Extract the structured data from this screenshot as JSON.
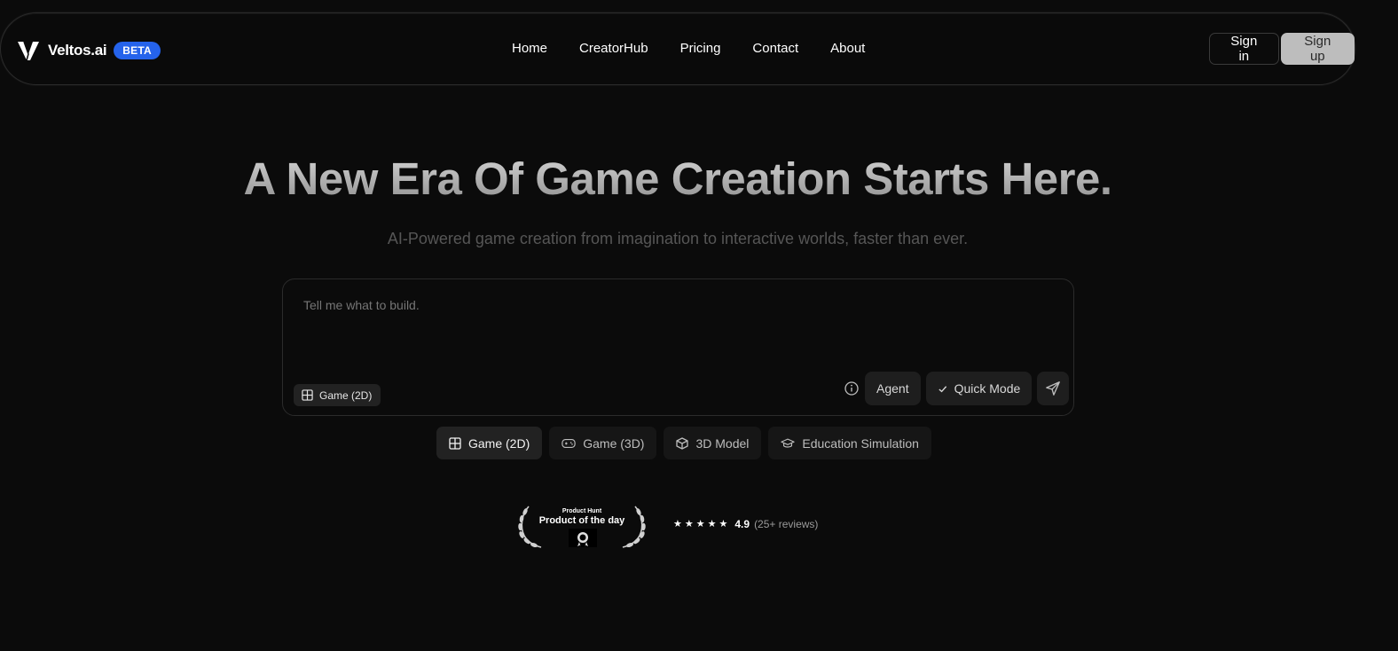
{
  "nav": {
    "brand_name": "Veltos.ai",
    "beta_label": "BETA",
    "links": [
      "Home",
      "CreatorHub",
      "Pricing",
      "Contact",
      "About"
    ],
    "signin_label": "Sign in",
    "signup_label": "Sign up"
  },
  "hero": {
    "title": "A New Era Of Game Creation Starts Here.",
    "subtitle": "AI-Powered game creation from imagination to interactive worlds, faster than ever."
  },
  "prompt": {
    "placeholder": "Tell me what to build.",
    "selected_mode": "Game (2D)",
    "agent_label": "Agent",
    "quick_mode_label": "Quick Mode"
  },
  "modes": [
    {
      "label": "Game (2D)",
      "icon": "grid-icon",
      "active": true
    },
    {
      "label": "Game (3D)",
      "icon": "gamepad-icon",
      "active": false
    },
    {
      "label": "3D Model",
      "icon": "cube-icon",
      "active": false
    },
    {
      "label": "Education Simulation",
      "icon": "graduation-cap-icon",
      "active": false
    }
  ],
  "product_hunt": {
    "small": "Product Hunt",
    "big": "Product of the day"
  },
  "rating": {
    "stars": 5,
    "value": "4.9",
    "count": "(25+ reviews)"
  },
  "colors": {
    "background": "#0b0b0b",
    "beta_badge": "#2563eb",
    "signup_bg": "#bdbdbd"
  }
}
